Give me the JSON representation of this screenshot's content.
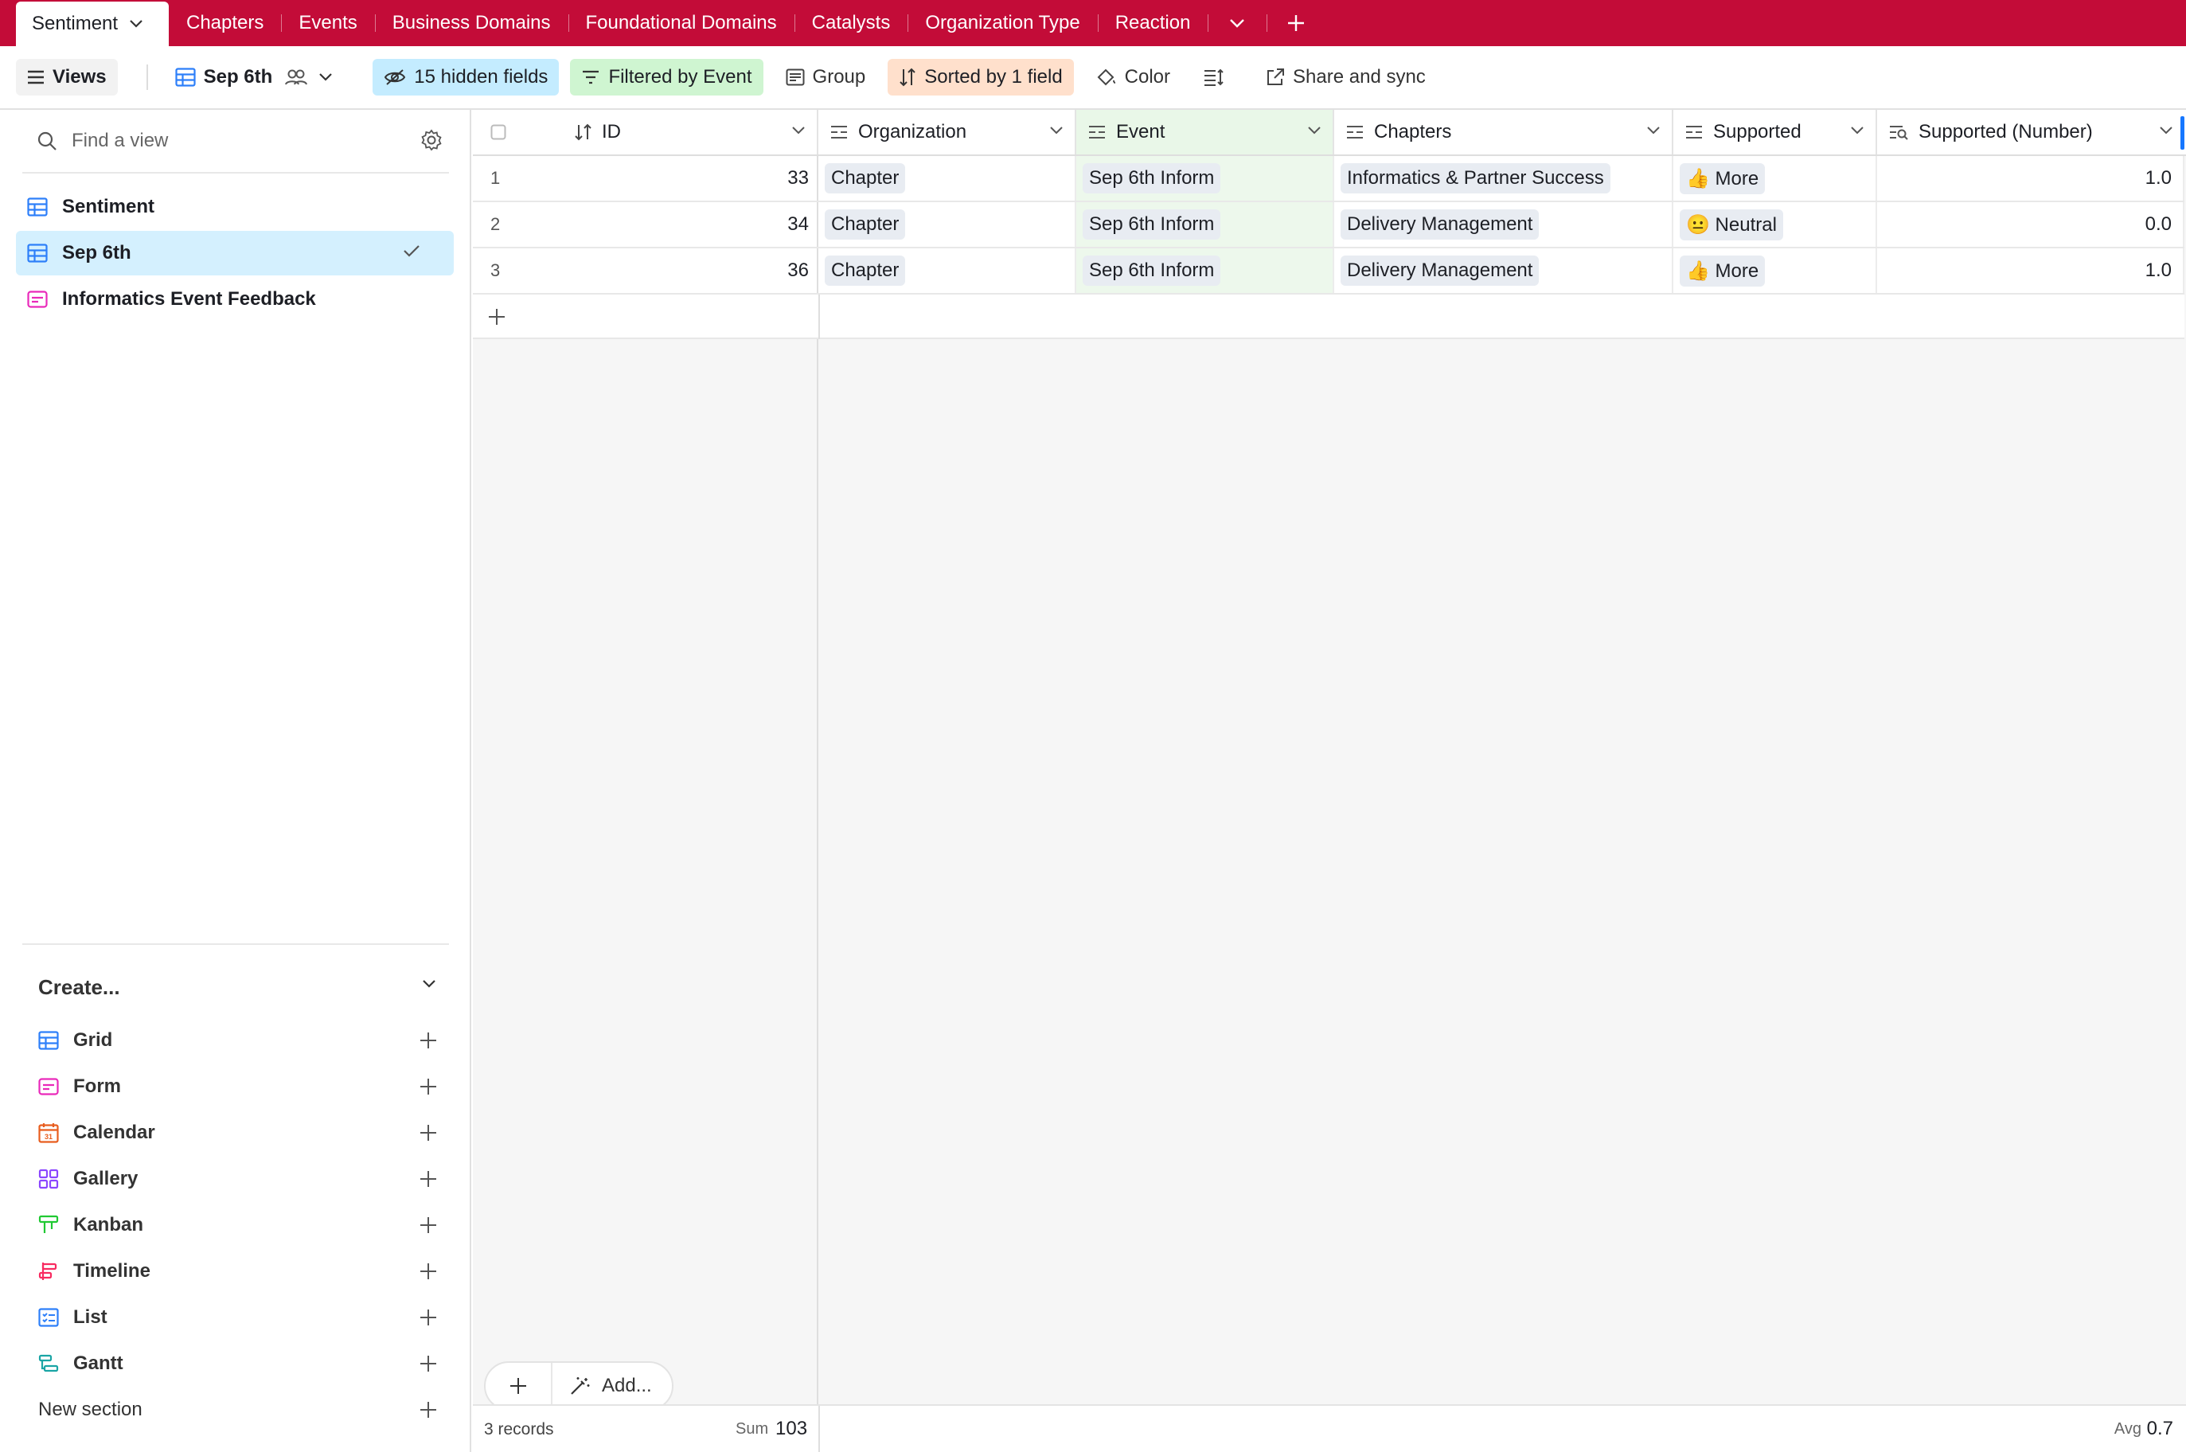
{
  "tabs": {
    "active": "Sentiment",
    "items": [
      "Chapters",
      "Events",
      "Business Domains",
      "Foundational Domains",
      "Catalysts",
      "Organization Type",
      "Reaction"
    ]
  },
  "toolbar": {
    "views_label": "Views",
    "current_view": "Sep 6th",
    "hidden_fields": "15 hidden fields",
    "filter": "Filtered by Event",
    "group": "Group",
    "sort": "Sorted by 1 field",
    "color": "Color",
    "share": "Share and sync"
  },
  "sidebar": {
    "search_placeholder": "Find a view",
    "views": [
      {
        "label": "Sentiment",
        "icon": "grid-icon"
      },
      {
        "label": "Sep 6th",
        "icon": "grid-icon",
        "selected": true
      },
      {
        "label": "Informatics Event Feedback",
        "icon": "form-icon"
      }
    ],
    "create_label": "Create...",
    "create_items": [
      {
        "label": "Grid",
        "icon": "grid-icon",
        "color": "#2d7ff9"
      },
      {
        "label": "Form",
        "icon": "form-icon",
        "color": "#e929ba"
      },
      {
        "label": "Calendar",
        "icon": "calendar-icon",
        "color": "#e85d1e"
      },
      {
        "label": "Gallery",
        "icon": "gallery-icon",
        "color": "#8b46ff"
      },
      {
        "label": "Kanban",
        "icon": "kanban-icon",
        "color": "#20c933"
      },
      {
        "label": "Timeline",
        "icon": "timeline-icon",
        "color": "#f82b60"
      },
      {
        "label": "List",
        "icon": "list-icon",
        "color": "#2d7ff9"
      },
      {
        "label": "Gantt",
        "icon": "gantt-icon",
        "color": "#1aa5a5"
      }
    ],
    "new_section": "New section"
  },
  "grid": {
    "columns": [
      "ID",
      "Organization",
      "Event",
      "Chapters",
      "Supported",
      "Supported (Number)"
    ],
    "rows": [
      {
        "num": "1",
        "id": "33",
        "org": "Chapter",
        "event": "Sep 6th Inform",
        "chapter": "Informatics & Partner Success",
        "supported": "👍 More",
        "supported_num": "1.0"
      },
      {
        "num": "2",
        "id": "34",
        "org": "Chapter",
        "event": "Sep 6th Inform",
        "chapter": "Delivery Management",
        "supported": "😐 Neutral",
        "supported_num": "0.0"
      },
      {
        "num": "3",
        "id": "36",
        "org": "Chapter",
        "event": "Sep 6th Inform",
        "chapter": "Delivery Management",
        "supported": "👍 More",
        "supported_num": "1.0"
      }
    ],
    "add_label": "Add...",
    "footer": {
      "records": "3 records",
      "sum_label": "Sum",
      "sum_value": "103",
      "avg_label": "Avg",
      "avg_value": "0.7"
    }
  },
  "colors": {
    "brand": "#c30c38",
    "selected_view": "#d4f0fe",
    "hidden_fields": "#c4ecff",
    "filter": "#cff5d1",
    "sort": "#ffe0cc"
  }
}
